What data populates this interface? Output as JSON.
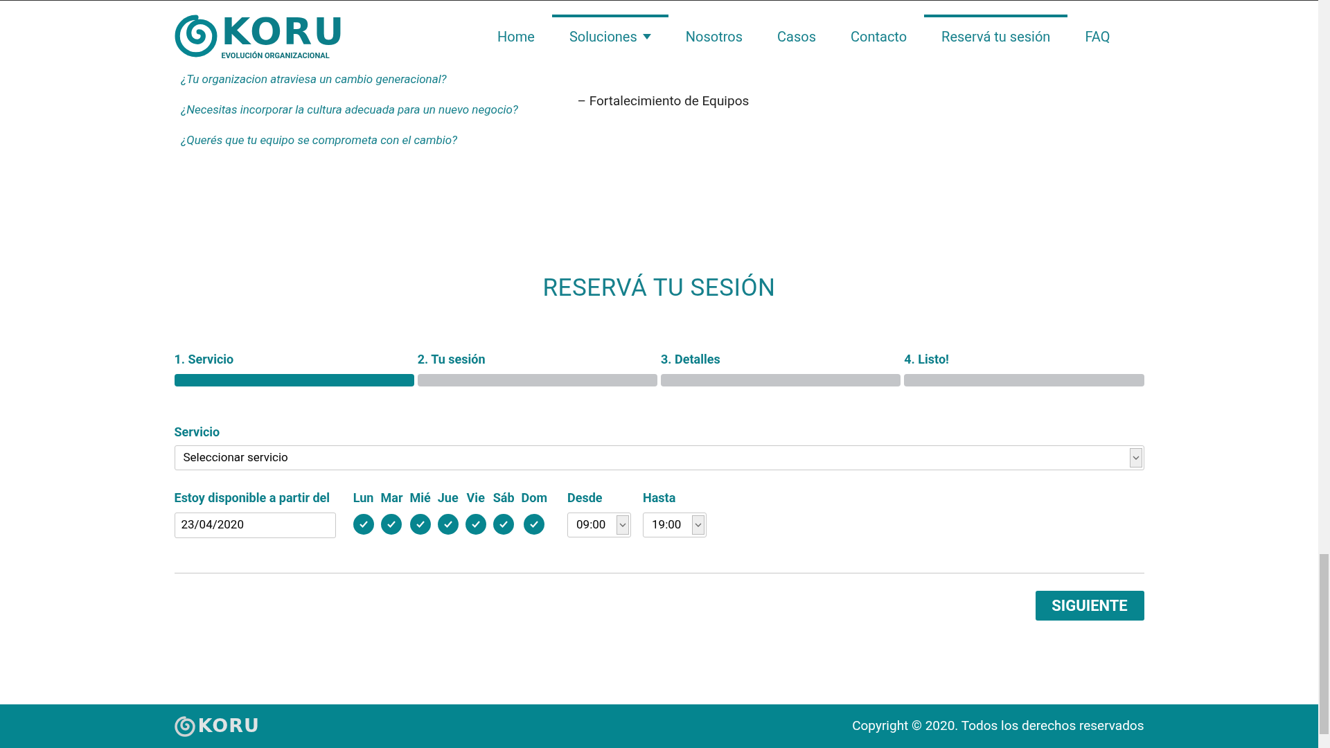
{
  "header": {
    "logo": {
      "name": "KORU",
      "tagline": "EVOLUCIÓN ORGANIZACIONAL"
    },
    "nav": [
      {
        "label": "Home",
        "highlighted": false,
        "has_dropdown": false
      },
      {
        "label": "Soluciones",
        "highlighted": true,
        "has_dropdown": true
      },
      {
        "label": "Nosotros",
        "highlighted": false,
        "has_dropdown": false
      },
      {
        "label": "Casos",
        "highlighted": false,
        "has_dropdown": false
      },
      {
        "label": "Contacto",
        "highlighted": false,
        "has_dropdown": false
      },
      {
        "label": "Reservá tu sesión",
        "highlighted": true,
        "has_dropdown": false
      },
      {
        "label": "FAQ",
        "highlighted": false,
        "has_dropdown": false
      }
    ]
  },
  "questions": [
    "¿Tu organizacion atraviesa un cambio generacional?",
    "¿Necesitas incorporar la cultura adecuada para un nuevo negocio?",
    "¿Querés que tu equipo se comprometa con el cambio?"
  ],
  "solutions": [
    "– Fortalecimiento de Equipos"
  ],
  "booking": {
    "title": "RESERVÁ TU SESIÓN",
    "steps": [
      {
        "label": "1. Servicio",
        "selected": true
      },
      {
        "label": "2. Tu sesión",
        "selected": false
      },
      {
        "label": "3. Detalles",
        "selected": false
      },
      {
        "label": "4. Listo!",
        "selected": false
      }
    ],
    "service": {
      "label": "Servicio",
      "value": "Seleccionar servicio"
    },
    "date": {
      "label": "Estoy disponible a partir del",
      "value": "23/04/2020"
    },
    "days": [
      {
        "label": "Lun",
        "checked": true
      },
      {
        "label": "Mar",
        "checked": true
      },
      {
        "label": "Mié",
        "checked": true
      },
      {
        "label": "Jue",
        "checked": true
      },
      {
        "label": "Vie",
        "checked": true
      },
      {
        "label": "Sáb",
        "checked": true
      },
      {
        "label": "Dom",
        "checked": true
      }
    ],
    "from": {
      "label": "Desde",
      "value": "09:00"
    },
    "to": {
      "label": "Hasta",
      "value": "19:00"
    },
    "next_button": "SIGUIENTE"
  },
  "footer": {
    "logo": "KORU",
    "copyright": "Copyright © 2020. Todos los derechos reservados"
  }
}
